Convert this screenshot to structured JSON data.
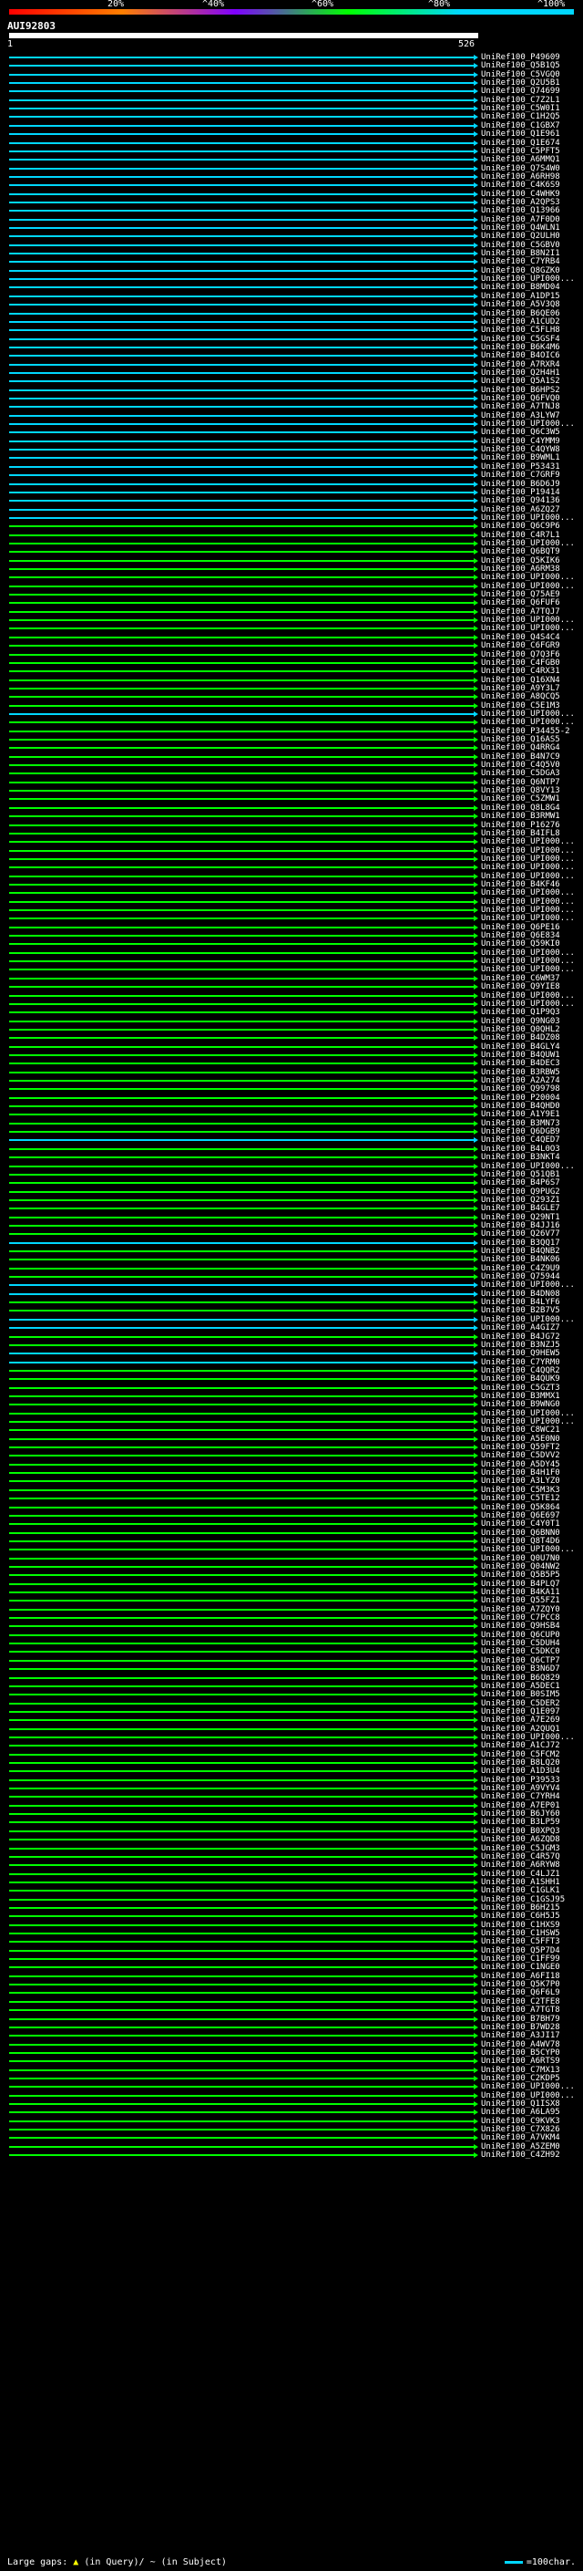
{
  "header": {
    "scale_labels": [
      "20%",
      "^40%",
      "^60%",
      "^80%",
      "^100%"
    ],
    "query_id": "AUI92803",
    "coord_start": "1",
    "coord_end": "526"
  },
  "colors": {
    "high": "#00d7ff",
    "mid": "#00ff00",
    "low": "#7f00ff",
    "very_low": "#ff7f00",
    "min": "#ff0000",
    "query": "#ffffff"
  },
  "hits": [
    {
      "id": "UniRef100_P49609",
      "c": "high"
    },
    {
      "id": "UniRef100_Q5B1Q5",
      "c": "high"
    },
    {
      "id": "UniRef100_C5VGQ0",
      "c": "high"
    },
    {
      "id": "UniRef100_Q2U5B1",
      "c": "high"
    },
    {
      "id": "UniRef100_Q74699",
      "c": "high"
    },
    {
      "id": "UniRef100_C7Z2L1",
      "c": "high"
    },
    {
      "id": "UniRef100_C5W0I1",
      "c": "high"
    },
    {
      "id": "UniRef100_C1H2Q5",
      "c": "high"
    },
    {
      "id": "UniRef100_C1GBX7",
      "c": "high"
    },
    {
      "id": "UniRef100_Q1E961",
      "c": "high"
    },
    {
      "id": "UniRef100_Q1E674",
      "c": "high"
    },
    {
      "id": "UniRef100_C5PFT5",
      "c": "high"
    },
    {
      "id": "UniRef100_A6MMQ1",
      "c": "high"
    },
    {
      "id": "UniRef100_Q7S4W0",
      "c": "high"
    },
    {
      "id": "UniRef100_A6RH98",
      "c": "high"
    },
    {
      "id": "UniRef100_C4K6S9",
      "c": "high"
    },
    {
      "id": "UniRef100_C4WHK9",
      "c": "high"
    },
    {
      "id": "UniRef100_A2QPS3",
      "c": "high"
    },
    {
      "id": "UniRef100_Q13966",
      "c": "high"
    },
    {
      "id": "UniRef100_A7F0D0",
      "c": "high"
    },
    {
      "id": "UniRef100_Q4WLN1",
      "c": "high"
    },
    {
      "id": "UniRef100_Q2ULH0",
      "c": "high"
    },
    {
      "id": "UniRef100_C5GBV0",
      "c": "high"
    },
    {
      "id": "UniRef100_B8N2I1",
      "c": "high"
    },
    {
      "id": "UniRef100_C7YRB4",
      "c": "high"
    },
    {
      "id": "UniRef100_Q8GZK0",
      "c": "high"
    },
    {
      "id": "UniRef100_UPI000...",
      "c": "high"
    },
    {
      "id": "UniRef100_B8MD04",
      "c": "high"
    },
    {
      "id": "UniRef100_A1DP15",
      "c": "high"
    },
    {
      "id": "UniRef100_A5V3Q8",
      "c": "high"
    },
    {
      "id": "UniRef100_B6QE06",
      "c": "high"
    },
    {
      "id": "UniRef100_A1CUD2",
      "c": "high"
    },
    {
      "id": "UniRef100_C5FLH8",
      "c": "high"
    },
    {
      "id": "UniRef100_C5GSF4",
      "c": "high"
    },
    {
      "id": "UniRef100_B6K4M6",
      "c": "high"
    },
    {
      "id": "UniRef100_B4OIC6",
      "c": "high"
    },
    {
      "id": "UniRef100_A7RXR4",
      "c": "high"
    },
    {
      "id": "UniRef100_Q2H4H1",
      "c": "high"
    },
    {
      "id": "UniRef100_Q5A1S2",
      "c": "high"
    },
    {
      "id": "UniRef100_B6HPS2",
      "c": "high"
    },
    {
      "id": "UniRef100_Q6FVQ0",
      "c": "high"
    },
    {
      "id": "UniRef100_A7TNJ8",
      "c": "high"
    },
    {
      "id": "UniRef100_A3LYW7",
      "c": "high"
    },
    {
      "id": "UniRef100_UPI000...",
      "c": "high"
    },
    {
      "id": "UniRef100_Q6C3W5",
      "c": "high"
    },
    {
      "id": "UniRef100_C4YMM9",
      "c": "high"
    },
    {
      "id": "UniRef100_C4QYW8",
      "c": "high"
    },
    {
      "id": "UniRef100_B9WML1",
      "c": "high"
    },
    {
      "id": "UniRef100_P53431",
      "c": "high"
    },
    {
      "id": "UniRef100_C7GRF9",
      "c": "high"
    },
    {
      "id": "UniRef100_B6D6J9",
      "c": "high"
    },
    {
      "id": "UniRef100_P19414",
      "c": "high"
    },
    {
      "id": "UniRef100_Q94136",
      "c": "high"
    },
    {
      "id": "UniRef100_A6ZQ27",
      "c": "high"
    },
    {
      "id": "UniRef100_UPI000...",
      "c": "high"
    },
    {
      "id": "UniRef100_Q6C9P6",
      "c": "mid"
    },
    {
      "id": "UniRef100_C4R7L1",
      "c": "mid"
    },
    {
      "id": "UniRef100_UPI000...",
      "c": "mid"
    },
    {
      "id": "UniRef100_Q6BQT9",
      "c": "mid"
    },
    {
      "id": "UniRef100_Q5KIK6",
      "c": "mid"
    },
    {
      "id": "UniRef100_A6RM38",
      "c": "mid"
    },
    {
      "id": "UniRef100_UPI000...",
      "c": "mid"
    },
    {
      "id": "UniRef100_UPI000...",
      "c": "mid"
    },
    {
      "id": "UniRef100_Q75AE9",
      "c": "mid"
    },
    {
      "id": "UniRef100_Q6FUF6",
      "c": "mid"
    },
    {
      "id": "UniRef100_A7TQJ7",
      "c": "mid"
    },
    {
      "id": "UniRef100_UPI000...",
      "c": "mid"
    },
    {
      "id": "UniRef100_UPI000...",
      "c": "mid"
    },
    {
      "id": "UniRef100_Q4S4C4",
      "c": "mid"
    },
    {
      "id": "UniRef100_C6FGR9",
      "c": "mid"
    },
    {
      "id": "UniRef100_Q7Q3F6",
      "c": "mid"
    },
    {
      "id": "UniRef100_C4FGB0",
      "c": "mid"
    },
    {
      "id": "UniRef100_C4RX31",
      "c": "mid"
    },
    {
      "id": "UniRef100_Q16XN4",
      "c": "mid"
    },
    {
      "id": "UniRef100_A9Y3L7",
      "c": "mid"
    },
    {
      "id": "UniRef100_A8QCQ5",
      "c": "mid"
    },
    {
      "id": "UniRef100_C5E1M3",
      "c": "mid"
    },
    {
      "id": "UniRef100_UPI000...",
      "c": "high"
    },
    {
      "id": "UniRef100_UPI000...",
      "c": "mid"
    },
    {
      "id": "UniRef100_P34455-2",
      "c": "mid"
    },
    {
      "id": "UniRef100_Q16AS5",
      "c": "mid"
    },
    {
      "id": "UniRef100_Q4RRG4",
      "c": "mid"
    },
    {
      "id": "UniRef100_B4N7C9",
      "c": "mid"
    },
    {
      "id": "UniRef100_C4Q5V0",
      "c": "mid"
    },
    {
      "id": "UniRef100_C5DGA3",
      "c": "mid"
    },
    {
      "id": "UniRef100_Q6NTP7",
      "c": "mid"
    },
    {
      "id": "UniRef100_Q8VY13",
      "c": "mid"
    },
    {
      "id": "UniRef100_C5ZMW1",
      "c": "mid"
    },
    {
      "id": "UniRef100_Q8L8G4",
      "c": "mid"
    },
    {
      "id": "UniRef100_B3RMW1",
      "c": "mid"
    },
    {
      "id": "UniRef100_P16276",
      "c": "mid"
    },
    {
      "id": "UniRef100_B4IFL8",
      "c": "mid"
    },
    {
      "id": "UniRef100_UPI000...",
      "c": "mid"
    },
    {
      "id": "UniRef100_UPI000...",
      "c": "mid"
    },
    {
      "id": "UniRef100_UPI000...",
      "c": "mid"
    },
    {
      "id": "UniRef100_UPI000...",
      "c": "mid"
    },
    {
      "id": "UniRef100_UPI000...",
      "c": "mid"
    },
    {
      "id": "UniRef100_B4KF46",
      "c": "mid"
    },
    {
      "id": "UniRef100_UPI000...",
      "c": "mid"
    },
    {
      "id": "UniRef100_UPI000...",
      "c": "mid"
    },
    {
      "id": "UniRef100_UPI000...",
      "c": "mid"
    },
    {
      "id": "UniRef100_UPI000...",
      "c": "mid"
    },
    {
      "id": "UniRef100_Q6PE16",
      "c": "mid"
    },
    {
      "id": "UniRef100_Q6E834",
      "c": "mid"
    },
    {
      "id": "UniRef100_Q59KI0",
      "c": "mid"
    },
    {
      "id": "UniRef100_UPI000...",
      "c": "mid"
    },
    {
      "id": "UniRef100_UPI000...",
      "c": "mid"
    },
    {
      "id": "UniRef100_UPI000...",
      "c": "mid"
    },
    {
      "id": "UniRef100_C6WM37",
      "c": "mid"
    },
    {
      "id": "UniRef100_Q9YIE8",
      "c": "mid"
    },
    {
      "id": "UniRef100_UPI000...",
      "c": "mid"
    },
    {
      "id": "UniRef100_UPI000...",
      "c": "mid"
    },
    {
      "id": "UniRef100_Q1P9Q3",
      "c": "mid"
    },
    {
      "id": "UniRef100_Q9NG03",
      "c": "mid"
    },
    {
      "id": "UniRef100_Q0QHL2",
      "c": "mid"
    },
    {
      "id": "UniRef100_B4DZ08",
      "c": "mid"
    },
    {
      "id": "UniRef100_B4GLY4",
      "c": "mid"
    },
    {
      "id": "UniRef100_B4QUW1",
      "c": "mid"
    },
    {
      "id": "UniRef100_B4DEC3",
      "c": "mid"
    },
    {
      "id": "UniRef100_B3RBW5",
      "c": "mid"
    },
    {
      "id": "UniRef100_A2A274",
      "c": "mid"
    },
    {
      "id": "UniRef100_Q99798",
      "c": "mid"
    },
    {
      "id": "UniRef100_P20004",
      "c": "mid"
    },
    {
      "id": "UniRef100_B4QHD0",
      "c": "mid"
    },
    {
      "id": "UniRef100_A1Y9E1",
      "c": "mid"
    },
    {
      "id": "UniRef100_B3MN73",
      "c": "mid"
    },
    {
      "id": "UniRef100_Q6DGB9",
      "c": "mid"
    },
    {
      "id": "UniRef100_C4QED7",
      "c": "high"
    },
    {
      "id": "UniRef100_B4L0O3",
      "c": "mid"
    },
    {
      "id": "UniRef100_B3NKT4",
      "c": "mid"
    },
    {
      "id": "UniRef100_UPI000...",
      "c": "mid"
    },
    {
      "id": "UniRef100_Q51QB1",
      "c": "mid"
    },
    {
      "id": "UniRef100_B4P6S7",
      "c": "mid"
    },
    {
      "id": "UniRef100_Q9PUG2",
      "c": "mid"
    },
    {
      "id": "UniRef100_Q293Z1",
      "c": "mid"
    },
    {
      "id": "UniRef100_B4GLE7",
      "c": "mid"
    },
    {
      "id": "UniRef100_Q29NT1",
      "c": "mid"
    },
    {
      "id": "UniRef100_B4JJ16",
      "c": "mid"
    },
    {
      "id": "UniRef100_Q26V77",
      "c": "mid"
    },
    {
      "id": "UniRef100_B3QQ17",
      "c": "high"
    },
    {
      "id": "UniRef100_B4QNB2",
      "c": "mid"
    },
    {
      "id": "UniRef100_B4NK06",
      "c": "mid"
    },
    {
      "id": "UniRef100_C4Z9U9",
      "c": "mid"
    },
    {
      "id": "UniRef100_Q75944",
      "c": "mid"
    },
    {
      "id": "UniRef100_UPI000...",
      "c": "high"
    },
    {
      "id": "UniRef100_B4DN08",
      "c": "high"
    },
    {
      "id": "UniRef100_B4LYF6",
      "c": "mid"
    },
    {
      "id": "UniRef100_B2B7V5",
      "c": "mid"
    },
    {
      "id": "UniRef100_UPI000...",
      "c": "high"
    },
    {
      "id": "UniRef100_A4GIZ7",
      "c": "high"
    },
    {
      "id": "UniRef100_B4JG72",
      "c": "mid"
    },
    {
      "id": "UniRef100_B3NZJ5",
      "c": "mid"
    },
    {
      "id": "UniRef100_Q9HEW5",
      "c": "high"
    },
    {
      "id": "UniRef100_C7YRM0",
      "c": "high"
    },
    {
      "id": "UniRef100_C4QQR2",
      "c": "mid"
    },
    {
      "id": "UniRef100_B4QUK9",
      "c": "mid"
    },
    {
      "id": "UniRef100_C5GZT3",
      "c": "mid"
    },
    {
      "id": "UniRef100_B3MMX1",
      "c": "mid"
    },
    {
      "id": "UniRef100_B9WNG0",
      "c": "mid"
    },
    {
      "id": "UniRef100_UPI000...",
      "c": "mid"
    },
    {
      "id": "UniRef100_UPI000...",
      "c": "mid"
    },
    {
      "id": "UniRef100_C8WC21",
      "c": "mid"
    },
    {
      "id": "UniRef100_A5E0N0",
      "c": "mid"
    },
    {
      "id": "UniRef100_Q59FT2",
      "c": "mid"
    },
    {
      "id": "UniRef100_C5DVV2",
      "c": "mid"
    },
    {
      "id": "UniRef100_A5DY45",
      "c": "mid"
    },
    {
      "id": "UniRef100_B4H1F0",
      "c": "mid"
    },
    {
      "id": "UniRef100_A3LYZ0",
      "c": "mid"
    },
    {
      "id": "UniRef100_C5M3K3",
      "c": "mid"
    },
    {
      "id": "UniRef100_C5TE12",
      "c": "mid"
    },
    {
      "id": "UniRef100_Q5K864",
      "c": "mid"
    },
    {
      "id": "UniRef100_Q6E697",
      "c": "mid"
    },
    {
      "id": "UniRef100_C4Y0T1",
      "c": "mid"
    },
    {
      "id": "UniRef100_Q6BNN0",
      "c": "mid"
    },
    {
      "id": "UniRef100_Q8T4D6",
      "c": "mid"
    },
    {
      "id": "UniRef100_UPI000...",
      "c": "mid"
    },
    {
      "id": "UniRef100_Q0U7N0",
      "c": "mid"
    },
    {
      "id": "UniRef100_Q04NW2",
      "c": "mid"
    },
    {
      "id": "UniRef100_Q5B5P5",
      "c": "mid"
    },
    {
      "id": "UniRef100_B4PLQ7",
      "c": "mid"
    },
    {
      "id": "UniRef100_B4KA11",
      "c": "mid"
    },
    {
      "id": "UniRef100_Q55FZ1",
      "c": "mid"
    },
    {
      "id": "UniRef100_A7ZQY0",
      "c": "mid"
    },
    {
      "id": "UniRef100_C7PCC8",
      "c": "mid"
    },
    {
      "id": "UniRef100_Q9HSB4",
      "c": "mid"
    },
    {
      "id": "UniRef100_Q6CUP0",
      "c": "mid"
    },
    {
      "id": "UniRef100_C5DUH4",
      "c": "mid"
    },
    {
      "id": "UniRef100_C5DKC0",
      "c": "mid"
    },
    {
      "id": "UniRef100_Q6CTP7",
      "c": "mid"
    },
    {
      "id": "UniRef100_B3N6D7",
      "c": "mid"
    },
    {
      "id": "UniRef100_B6Q829",
      "c": "mid"
    },
    {
      "id": "UniRef100_A5DEC1",
      "c": "mid"
    },
    {
      "id": "UniRef100_B0SIM5",
      "c": "mid"
    },
    {
      "id": "UniRef100_C5DER2",
      "c": "mid"
    },
    {
      "id": "UniRef100_Q1E097",
      "c": "mid"
    },
    {
      "id": "UniRef100_A7E269",
      "c": "mid"
    },
    {
      "id": "UniRef100_A2QUQ1",
      "c": "mid"
    },
    {
      "id": "UniRef100_UPI000...",
      "c": "mid"
    },
    {
      "id": "UniRef100_A1CJ72",
      "c": "mid"
    },
    {
      "id": "UniRef100_C5FCM2",
      "c": "mid"
    },
    {
      "id": "UniRef100_B8LQ20",
      "c": "mid"
    },
    {
      "id": "UniRef100_A1D3U4",
      "c": "mid"
    },
    {
      "id": "UniRef100_P39533",
      "c": "mid"
    },
    {
      "id": "UniRef100_A9VYV4",
      "c": "mid"
    },
    {
      "id": "UniRef100_C7YRH4",
      "c": "mid"
    },
    {
      "id": "UniRef100_A7EP01",
      "c": "mid"
    },
    {
      "id": "UniRef100_B6JY60",
      "c": "mid"
    },
    {
      "id": "UniRef100_B3LP59",
      "c": "mid"
    },
    {
      "id": "UniRef100_B0XPQ3",
      "c": "mid"
    },
    {
      "id": "UniRef100_A6ZQD8",
      "c": "mid"
    },
    {
      "id": "UniRef100_C5JGM3",
      "c": "mid"
    },
    {
      "id": "UniRef100_C4R57Q",
      "c": "mid"
    },
    {
      "id": "UniRef100_A6RYW8",
      "c": "mid"
    },
    {
      "id": "UniRef100_C4LJZ1",
      "c": "mid"
    },
    {
      "id": "UniRef100_A1SHH1",
      "c": "mid"
    },
    {
      "id": "UniRef100_C1GLK1",
      "c": "mid"
    },
    {
      "id": "UniRef100_C1GSJ95",
      "c": "mid"
    },
    {
      "id": "UniRef100_B6H215",
      "c": "mid"
    },
    {
      "id": "UniRef100_C6H5J5",
      "c": "mid"
    },
    {
      "id": "UniRef100_C1HXS9",
      "c": "mid"
    },
    {
      "id": "UniRef100_C1HSW5",
      "c": "mid"
    },
    {
      "id": "UniRef100_C5FFT3",
      "c": "mid"
    },
    {
      "id": "UniRef100_Q5P7D4",
      "c": "mid"
    },
    {
      "id": "UniRef100_C1FF99",
      "c": "mid"
    },
    {
      "id": "UniRef100_C1NGE0",
      "c": "mid"
    },
    {
      "id": "UniRef100_A6FI18",
      "c": "mid"
    },
    {
      "id": "UniRef100_Q5K7P0",
      "c": "mid"
    },
    {
      "id": "UniRef100_Q6F6L9",
      "c": "mid"
    },
    {
      "id": "UniRef100_C2TFE8",
      "c": "mid"
    },
    {
      "id": "UniRef100_A7TGT8",
      "c": "mid"
    },
    {
      "id": "UniRef100_B7BH79",
      "c": "mid"
    },
    {
      "id": "UniRef100_B7WD28",
      "c": "mid"
    },
    {
      "id": "UniRef100_A3JI17",
      "c": "mid"
    },
    {
      "id": "UniRef100_A4WV78",
      "c": "mid"
    },
    {
      "id": "UniRef100_B5CYP0",
      "c": "mid"
    },
    {
      "id": "UniRef100_A6RTS9",
      "c": "mid"
    },
    {
      "id": "UniRef100_C7MX13",
      "c": "mid"
    },
    {
      "id": "UniRef100_C2KDP5",
      "c": "mid"
    },
    {
      "id": "UniRef100_UPI000...",
      "c": "mid"
    },
    {
      "id": "UniRef100_UPI000...",
      "c": "mid"
    },
    {
      "id": "UniRef100_Q1ISX8",
      "c": "mid"
    },
    {
      "id": "UniRef100_A6LA95",
      "c": "mid"
    },
    {
      "id": "UniRef100_C9KVK3",
      "c": "mid"
    },
    {
      "id": "UniRef100_C7X826",
      "c": "mid"
    },
    {
      "id": "UniRef100_A7VKM4",
      "c": "mid"
    },
    {
      "id": "UniRef100_A5ZEM0",
      "c": "mid"
    },
    {
      "id": "UniRef100_C4ZH92",
      "c": "mid"
    }
  ],
  "footer": {
    "gaps_label": "Large gaps:",
    "gaps_query": "(in Query)/",
    "gaps_subject": "(in Subject)",
    "legend_label": "=100char."
  }
}
